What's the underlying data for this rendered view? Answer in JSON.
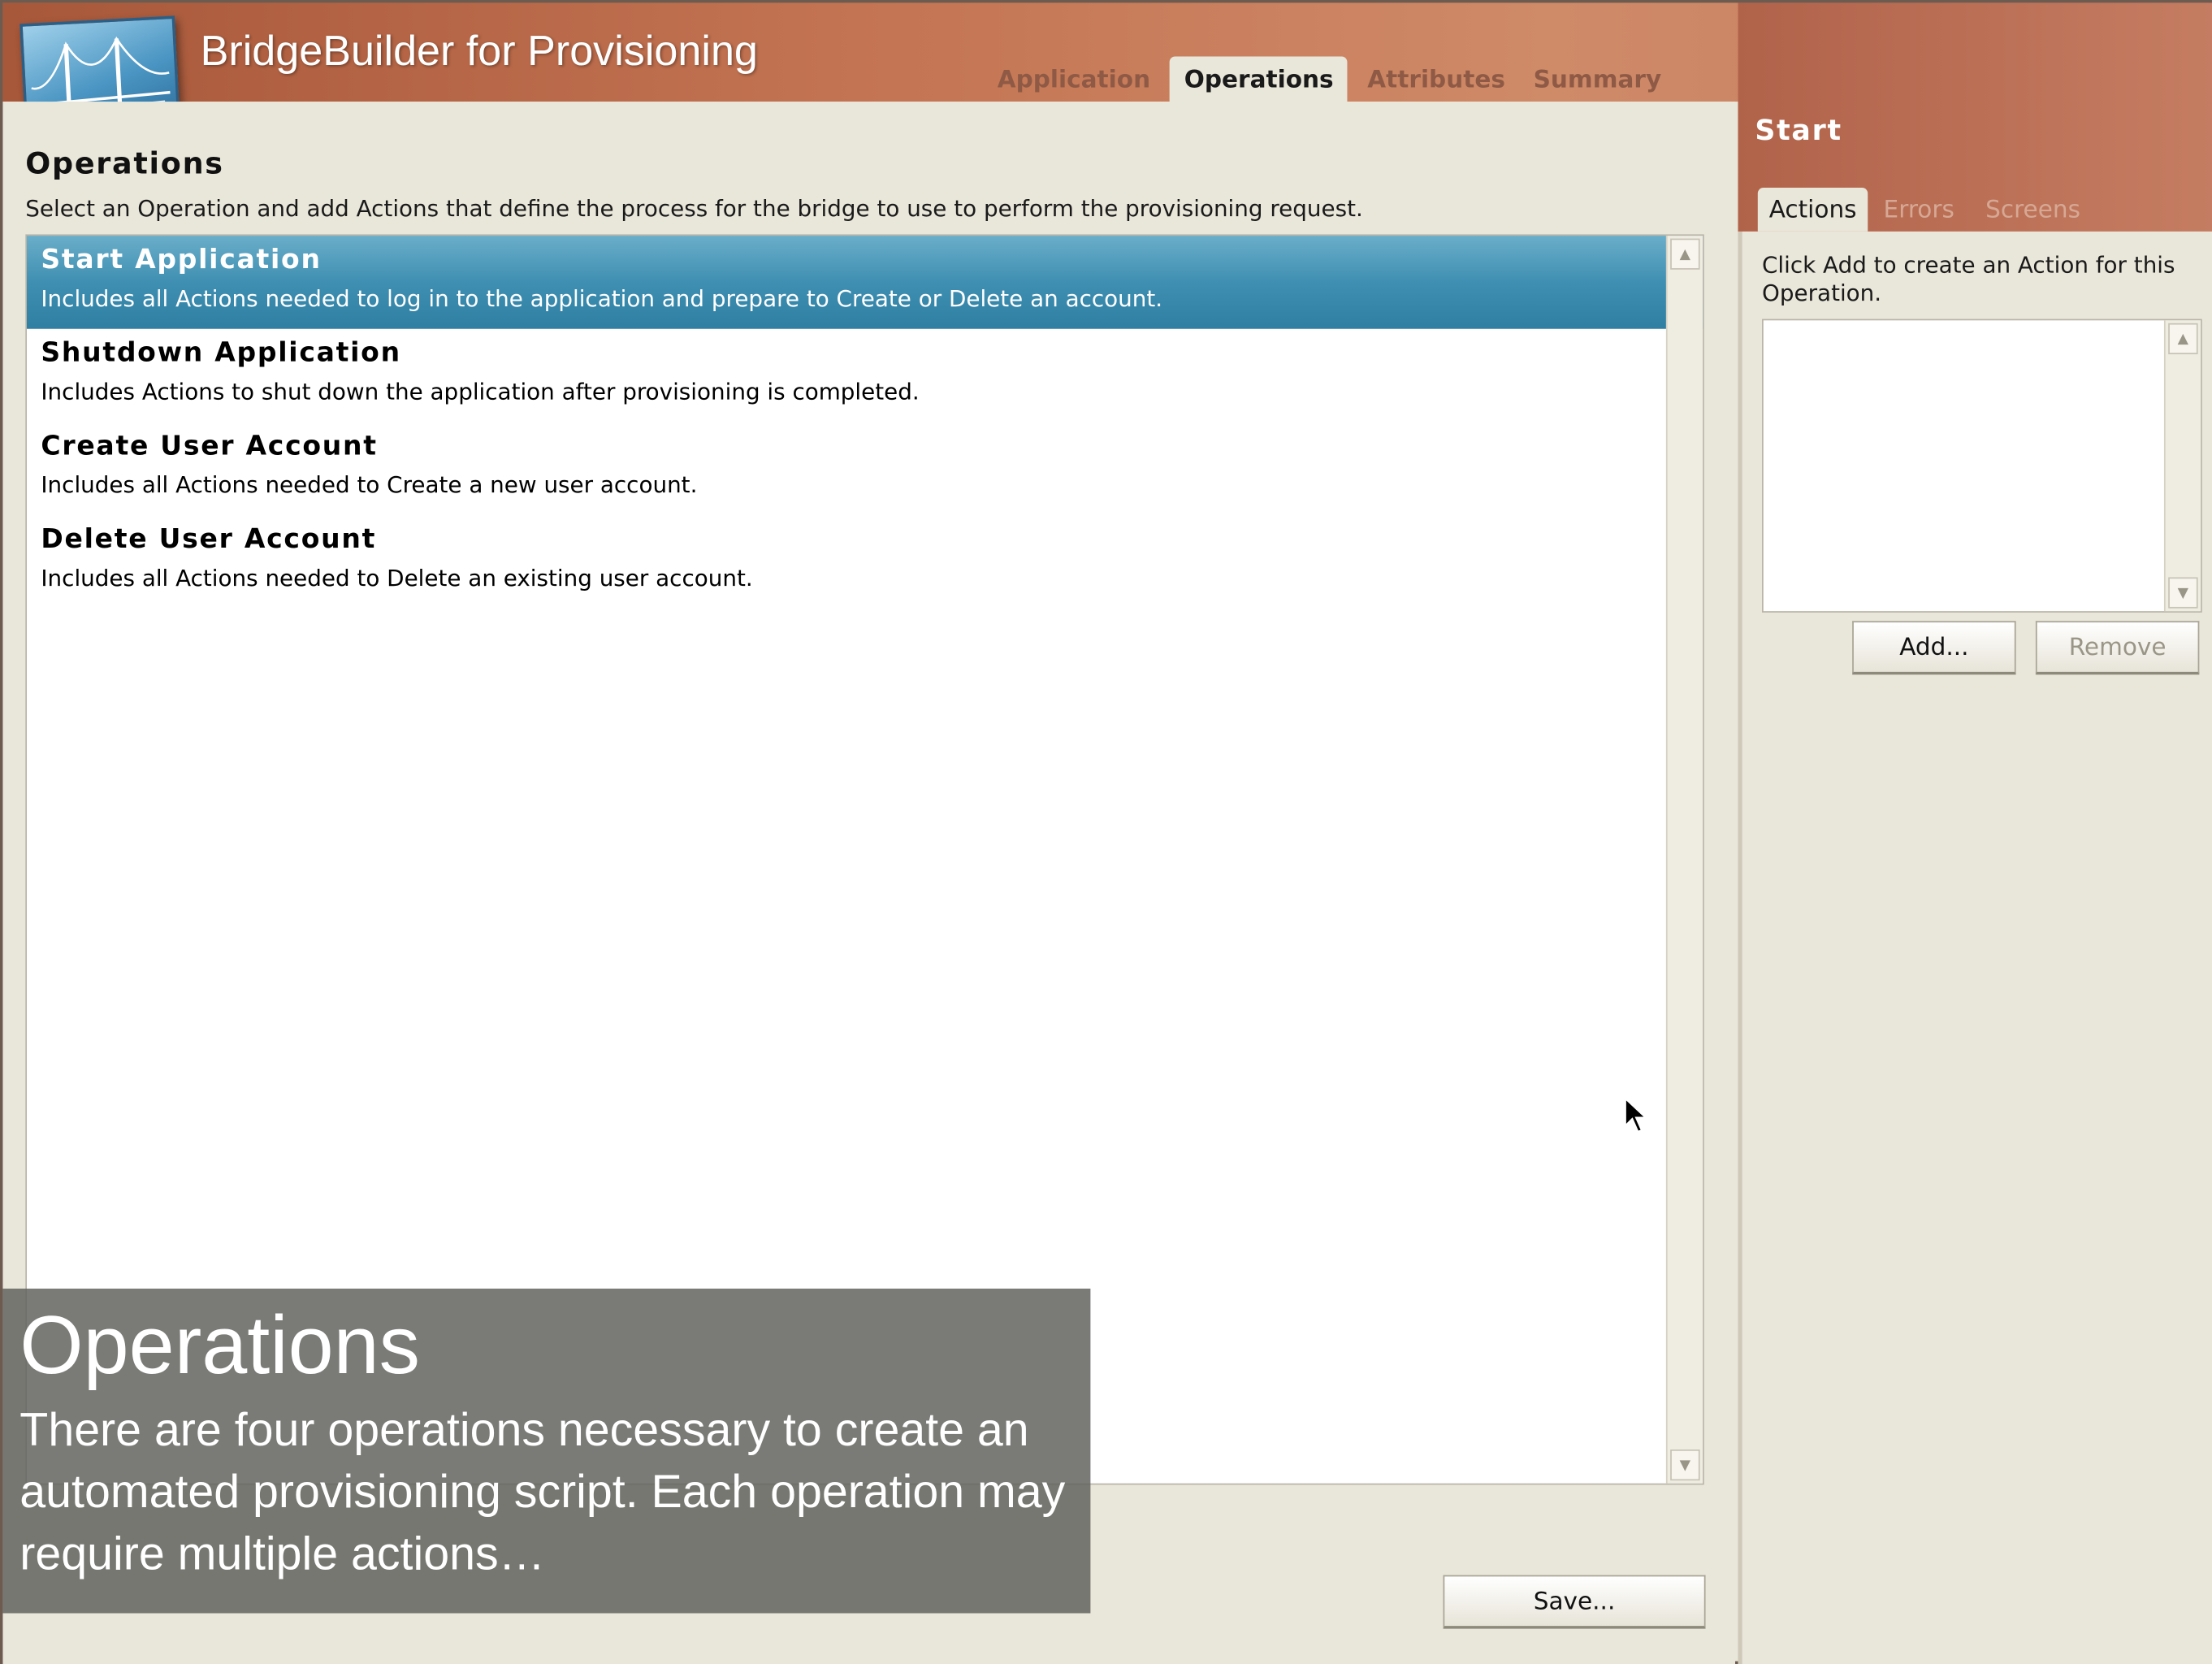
{
  "app": {
    "title": "BridgeBuilder for Provisioning"
  },
  "tabs": [
    {
      "label": "Application"
    },
    {
      "label": "Operations"
    },
    {
      "label": "Attributes"
    },
    {
      "label": "Summary"
    }
  ],
  "window_controls": {
    "help": "?",
    "minimize": "_",
    "close": "✕"
  },
  "main": {
    "title": "Operations",
    "description": "Select an Operation and add Actions that define the process for the bridge to use to perform the provisioning request.",
    "operations": [
      {
        "name": "Start Application",
        "description": "Includes all Actions needed to log in to the application and prepare to Create or Delete an account."
      },
      {
        "name": "Shutdown Application",
        "description": "Includes Actions to shut down the application after provisioning is completed."
      },
      {
        "name": "Create User Account",
        "description": "Includes all Actions needed to Create a new user account."
      },
      {
        "name": "Delete User Account",
        "description": "Includes all Actions needed to Delete an existing user account."
      }
    ],
    "save_label": "Save..."
  },
  "side": {
    "title": "Start",
    "tabs": [
      {
        "label": "Actions"
      },
      {
        "label": "Errors"
      },
      {
        "label": "Screens"
      }
    ],
    "hint": "Click Add to create an Action for this Operation.",
    "add_label": "Add...",
    "remove_label": "Remove"
  },
  "caption": {
    "title": "Operations",
    "body": "There are four operations necessary to create an automated provisioning script. Each operation may require multiple actions…"
  },
  "colors": {
    "header": "#c47553",
    "selected_row": "#3f8fb2",
    "panel_bg": "#e9e6da"
  }
}
